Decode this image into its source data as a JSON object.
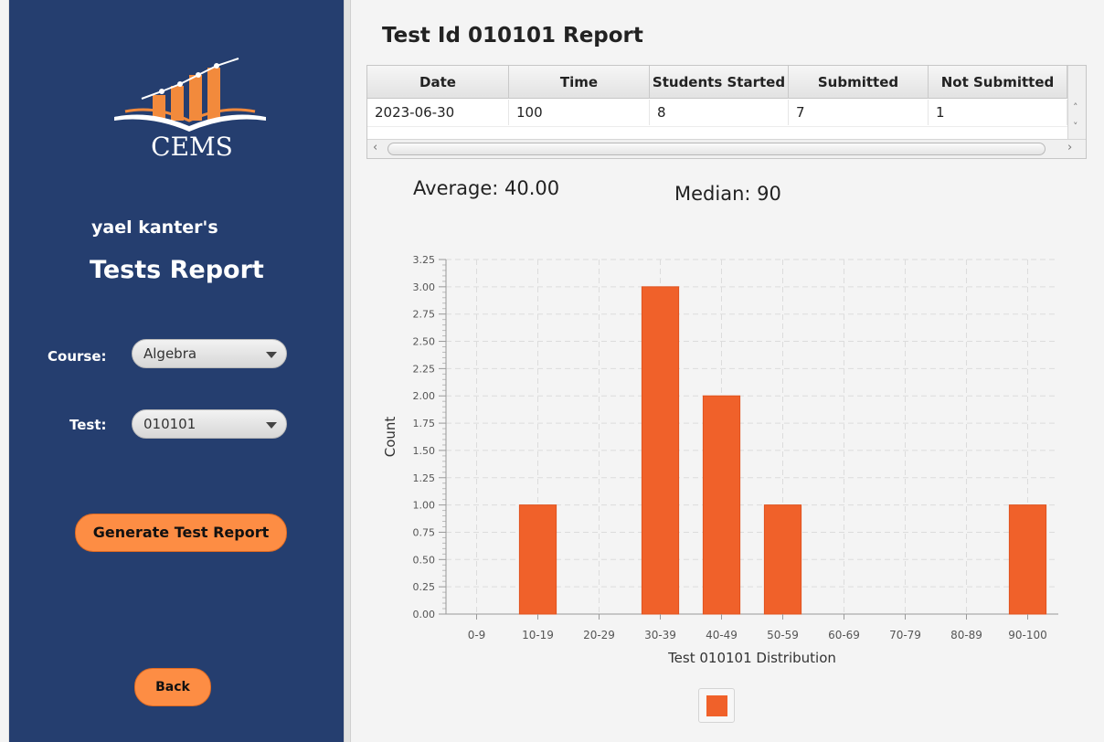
{
  "app": {
    "logo_text": "CEMS"
  },
  "sidebar": {
    "user_name": "yael kanter's",
    "title": "Tests Report",
    "course_label": "Course:",
    "course_value": "Algebra",
    "test_label": "Test:",
    "test_value": "010101",
    "generate_button": "Generate Test Report",
    "back_button": "Back"
  },
  "main": {
    "title": "Test Id 010101 Report",
    "table": {
      "columns": [
        "Date",
        "Time",
        "Students Started",
        "Submitted",
        "Not Submitted"
      ],
      "rows": [
        [
          "2023-06-30",
          "100",
          "8",
          "7",
          "1"
        ]
      ]
    },
    "average_text": "Average: 40.00",
    "median_text": "Median: 90"
  },
  "colors": {
    "sidebar_bg": "#253e6f",
    "accent_orange": "#fd8d44",
    "bar_color": "#f0612a"
  },
  "chart_data": {
    "type": "bar",
    "categories": [
      "0-9",
      "10-19",
      "20-29",
      "30-39",
      "40-49",
      "50-59",
      "60-69",
      "70-79",
      "80-89",
      "90-100"
    ],
    "values": [
      0,
      1,
      0,
      3,
      2,
      1,
      0,
      0,
      0,
      1
    ],
    "xlabel": "Test 010101 Distribution",
    "ylabel": "Count",
    "ylim": [
      0,
      3.25
    ],
    "yticks": [
      "0.00",
      "0.25",
      "0.50",
      "0.75",
      "1.00",
      "1.25",
      "1.50",
      "1.75",
      "2.00",
      "2.25",
      "2.50",
      "2.75",
      "3.00",
      "3.25"
    ],
    "grid": true,
    "legend": "bottom"
  }
}
